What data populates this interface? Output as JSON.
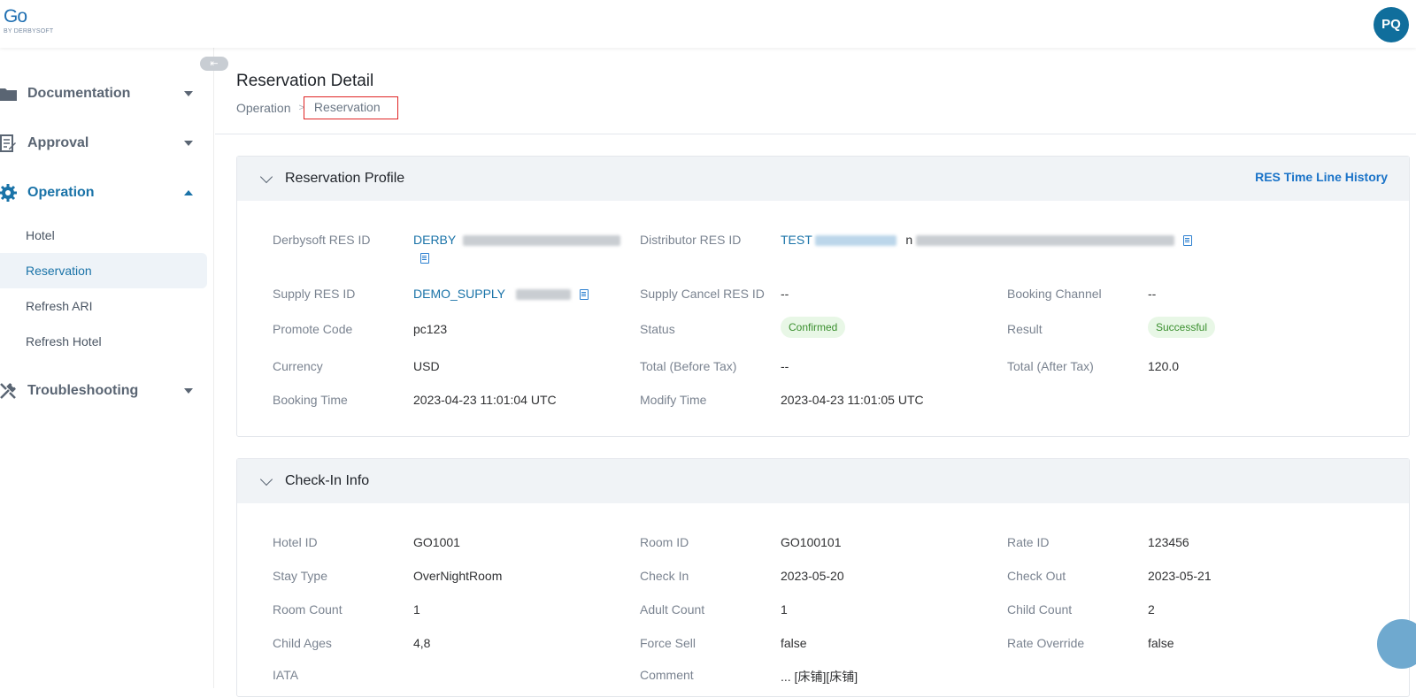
{
  "topbar": {
    "logo": "Go",
    "logo_sub": "BY DERBYSOFT",
    "avatar_initials": "PQ"
  },
  "sidebar": {
    "groups": [
      {
        "label": "Documentation",
        "icon": "folder-icon"
      },
      {
        "label": "Approval",
        "icon": "edit-doc-icon"
      },
      {
        "label": "Operation",
        "icon": "gear-icon"
      },
      {
        "label": "Troubleshooting",
        "icon": "tools-icon"
      }
    ],
    "operation_items": [
      {
        "label": "Hotel"
      },
      {
        "label": "Reservation"
      },
      {
        "label": "Refresh ARI"
      },
      {
        "label": "Refresh Hotel"
      }
    ]
  },
  "page": {
    "title": "Reservation Detail",
    "breadcrumb": [
      "Operation",
      "Reservation"
    ],
    "breadcrumb_sep": ">"
  },
  "profile": {
    "title": "Reservation Profile",
    "link": "RES Time Line History",
    "fields": {
      "derbysoft_res_id": {
        "label": "Derbysoft RES ID",
        "value": "DERBY"
      },
      "distributor_res_id": {
        "label": "Distributor RES ID",
        "value": "TEST",
        "value2": "n"
      },
      "supply_res_id": {
        "label": "Supply RES ID",
        "value": "DEMO_SUPPLY"
      },
      "supply_cancel_res_id": {
        "label": "Supply Cancel RES ID",
        "value": "--"
      },
      "booking_channel": {
        "label": "Booking Channel",
        "value": "--"
      },
      "promote_code": {
        "label": "Promote Code",
        "value": "pc123"
      },
      "status": {
        "label": "Status",
        "value": "Confirmed"
      },
      "result": {
        "label": "Result",
        "value": "Successful"
      },
      "currency": {
        "label": "Currency",
        "value": "USD"
      },
      "total_before_tax": {
        "label": "Total (Before Tax)",
        "value": "--"
      },
      "total_after_tax": {
        "label": "Total (After Tax)",
        "value": "120.0"
      },
      "booking_time": {
        "label": "Booking Time",
        "value": "2023-04-23 11:01:04 UTC"
      },
      "modify_time": {
        "label": "Modify Time",
        "value": "2023-04-23 11:01:05 UTC"
      }
    }
  },
  "checkin": {
    "title": "Check-In Info",
    "fields": {
      "hotel_id": {
        "label": "Hotel ID",
        "value": "GO1001"
      },
      "room_id": {
        "label": "Room ID",
        "value": "GO100101"
      },
      "rate_id": {
        "label": "Rate ID",
        "value": "123456"
      },
      "stay_type": {
        "label": "Stay Type",
        "value": "OverNightRoom"
      },
      "check_in": {
        "label": "Check In",
        "value": "2023-05-20"
      },
      "check_out": {
        "label": "Check Out",
        "value": "2023-05-21"
      },
      "room_count": {
        "label": "Room Count",
        "value": "1"
      },
      "adult_count": {
        "label": "Adult Count",
        "value": "1"
      },
      "child_count": {
        "label": "Child Count",
        "value": "2"
      },
      "child_ages": {
        "label": "Child Ages",
        "value": "4,8"
      },
      "force_sell": {
        "label": "Force Sell",
        "value": "false"
      },
      "rate_override": {
        "label": "Rate Override",
        "value": "false"
      },
      "iata": {
        "label": "IATA"
      },
      "comment": {
        "label": "Comment",
        "value": "... [床铺][床铺]"
      }
    }
  },
  "colors": {
    "accent": "#1a73a8",
    "avatar": "#106e9c",
    "success_bg": "#e8f7e6",
    "highlight_box": "#e02424"
  }
}
